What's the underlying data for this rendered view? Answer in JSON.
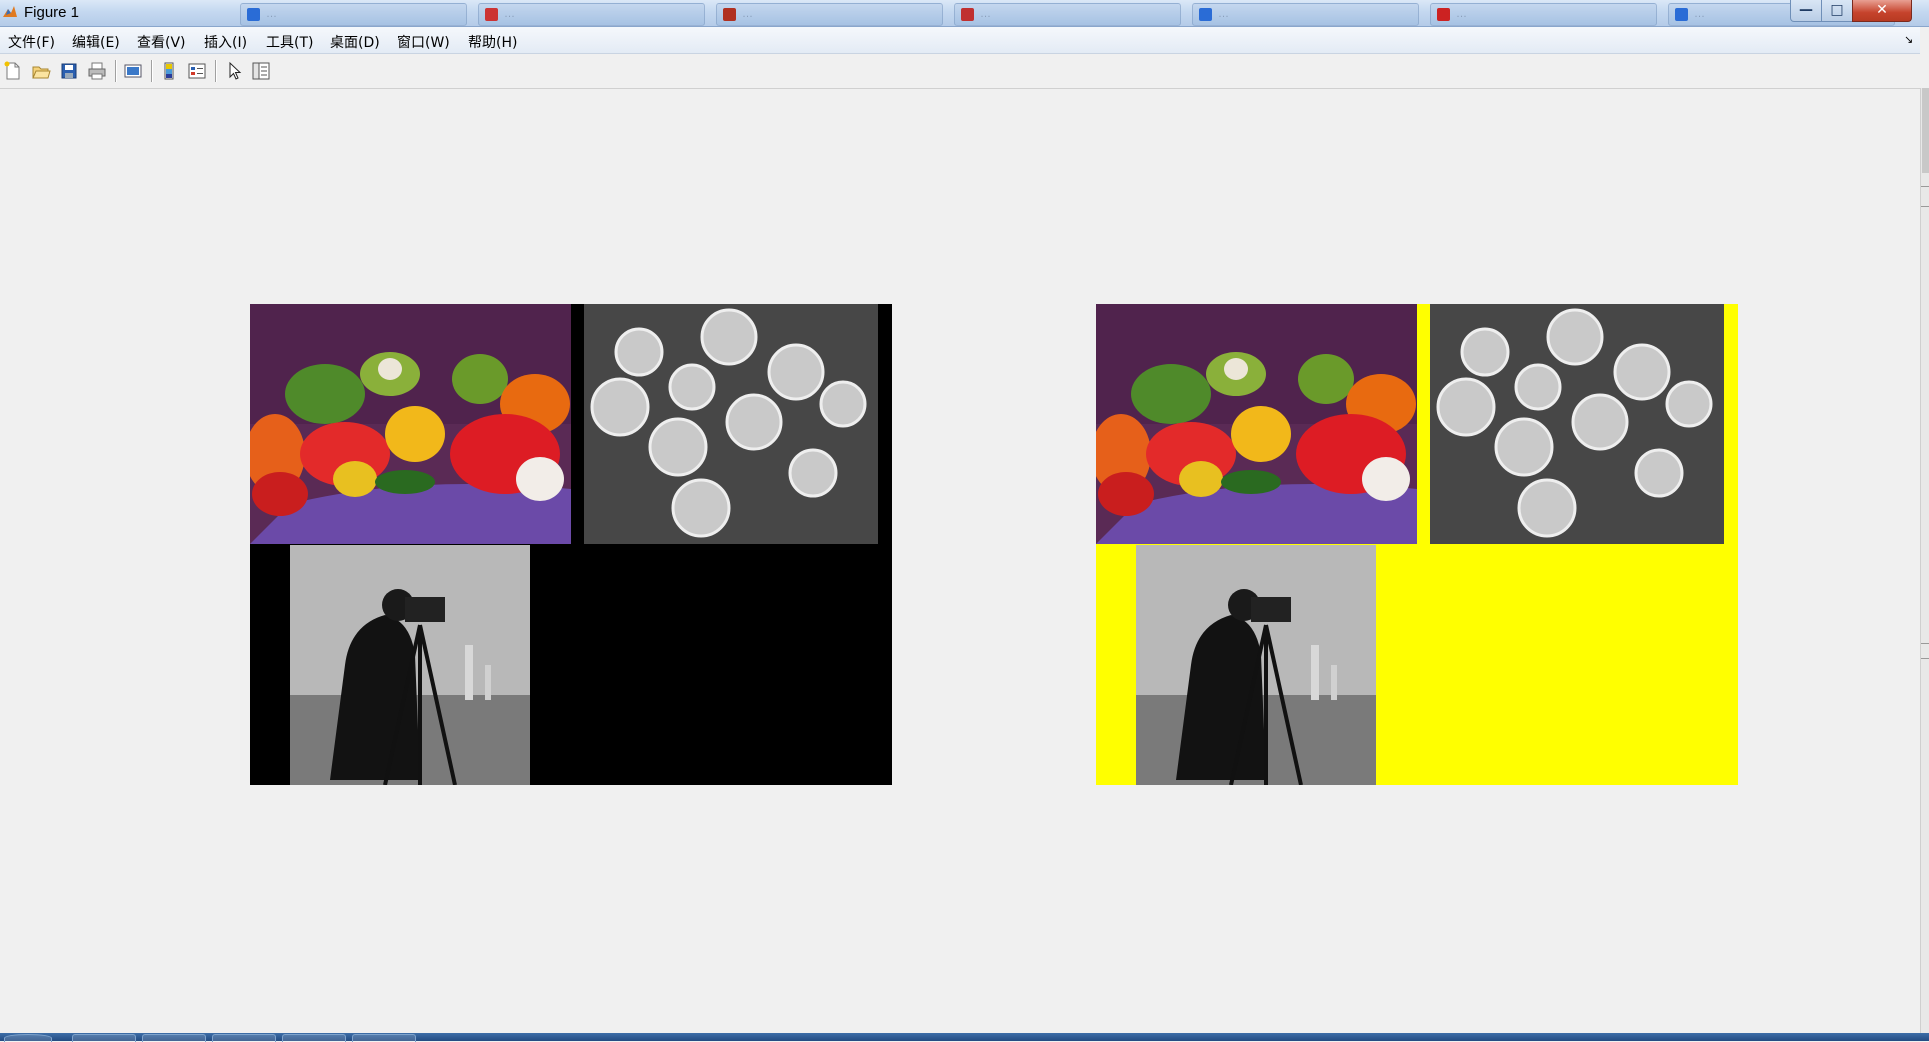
{
  "window": {
    "title": "Figure 1",
    "background_tabs": [
      {
        "text": "…",
        "favicon_color": "#2a6cd6"
      },
      {
        "text": "…",
        "favicon_color": "#cc3333"
      },
      {
        "text": "…",
        "favicon_color": "#b03020"
      },
      {
        "text": "…",
        "favicon_color": "#c03030"
      },
      {
        "text": "…",
        "favicon_color": "#2a6cd6"
      },
      {
        "text": "…",
        "favicon_color": "#cc2222"
      },
      {
        "text": "…",
        "favicon_color": "#2a6cd6"
      }
    ],
    "controls": {
      "minimize": "—",
      "maximize": "□",
      "close": "✕"
    }
  },
  "menubar": {
    "items": [
      {
        "label": "文件(F)"
      },
      {
        "label": "编辑(E)"
      },
      {
        "label": "查看(V)"
      },
      {
        "label": "插入(I)"
      },
      {
        "label": "工具(T)"
      },
      {
        "label": "桌面(D)"
      },
      {
        "label": "窗口(W)"
      },
      {
        "label": "帮助(H)"
      }
    ],
    "dock_glyph": "↘"
  },
  "toolbar": {
    "buttons": [
      "new-figure-icon",
      "open-file-icon",
      "save-icon",
      "print-icon",
      "print-preview-icon",
      "colorbar-icon",
      "legend-icon",
      "pointer-icon",
      "property-editor-icon"
    ]
  },
  "figure": {
    "left_axes": {
      "background": "#000000",
      "tiles": [
        "peppers",
        "coins",
        "cameraman"
      ]
    },
    "right_axes": {
      "background": "#ffff00",
      "tiles": [
        "peppers",
        "coins",
        "cameraman"
      ]
    }
  },
  "colors": {
    "figure_background": "#f0f0f0",
    "fill_black": "#000000",
    "fill_yellow": "#ffff00"
  }
}
